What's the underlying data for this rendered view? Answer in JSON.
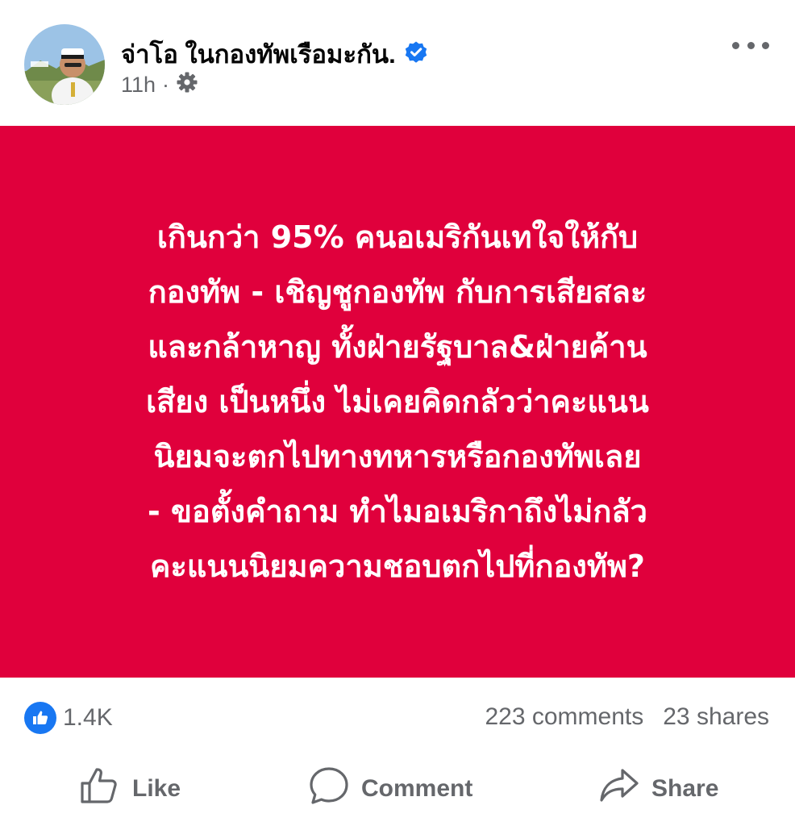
{
  "post": {
    "author": "จ่าโอ ในกองทัพเรือมะกัน.",
    "verified_icon": "verified-badge-icon",
    "timestamp": "11h",
    "separator": "·",
    "audience_icon": "gear-icon",
    "menu_icon": "more-options-icon"
  },
  "banner": {
    "background": "#e0003c",
    "text_color": "#ffffff",
    "lines": [
      "เกินกว่า 95% คนอเมริกันเทใจให้กับ",
      "กองทัพ - เชิญชูกองทัพ กับการเสียสละ",
      "และกล้าหาญ ทั้งฝ่ายรัฐบาล&ฝ่ายค้าน",
      "เสียง เป็นหนึ่ง ไม่เคยคิดกลัวว่าคะแนน",
      "นิยมจะตกไปทางทหารหรือกองทัพเลย",
      "- ขอตั้งคำถาม ทำไมอเมริกาถึงไม่กลัว",
      "คะแนนนิยมความชอบตกไปที่กองทัพ?"
    ]
  },
  "stats": {
    "reaction_icon": "like-reaction-icon",
    "reaction_count": "1.4K",
    "comments": "223 comments",
    "shares": "23 shares"
  },
  "actions": {
    "like": "Like",
    "comment": "Comment",
    "share": "Share"
  },
  "colors": {
    "accent": "#1877f2",
    "secondary_text": "#65676b",
    "primary_text": "#050505"
  }
}
